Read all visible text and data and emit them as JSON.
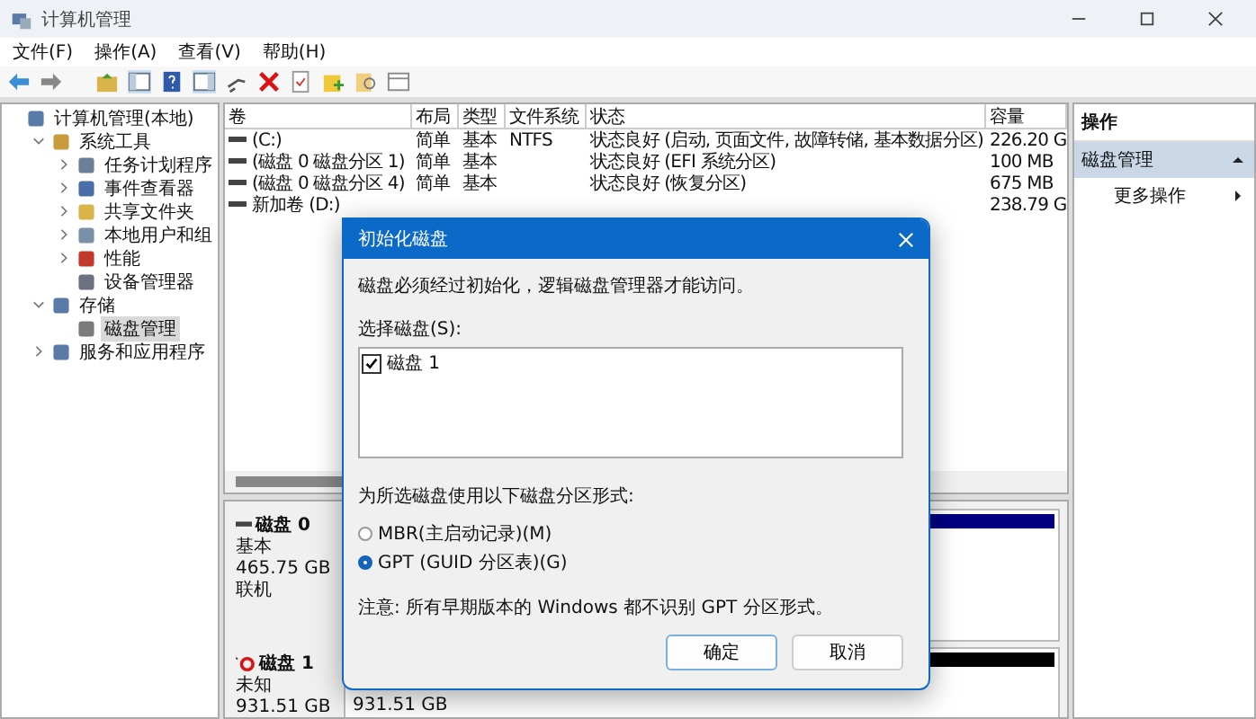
{
  "window": {
    "title": "计算机管理"
  },
  "menu": [
    "文件(F)",
    "操作(A)",
    "查看(V)",
    "帮助(H)"
  ],
  "tree": [
    {
      "label": "计算机管理(本地)",
      "children": [
        {
          "label": "系统工具",
          "expanded": true,
          "children": [
            {
              "label": "任务计划程序",
              "expanded": false
            },
            {
              "label": "事件查看器",
              "expanded": false
            },
            {
              "label": "共享文件夹",
              "expanded": false
            },
            {
              "label": "本地用户和组",
              "expanded": false
            },
            {
              "label": "性能",
              "expanded": false
            },
            {
              "label": "设备管理器"
            }
          ]
        },
        {
          "label": "存储",
          "expanded": true,
          "children": [
            {
              "label": "磁盘管理",
              "selected": true
            }
          ]
        },
        {
          "label": "服务和应用程序",
          "expanded": false
        }
      ]
    }
  ],
  "volumes": {
    "columns": [
      "卷",
      "布局",
      "类型",
      "文件系统",
      "状态",
      "容量"
    ],
    "rows": [
      {
        "volume": "(C:)",
        "layout": "简单",
        "type": "基本",
        "fs": "NTFS",
        "status": "状态良好 (启动, 页面文件, 故障转储, 基本数据分区)",
        "capacity": "226.20 G"
      },
      {
        "volume": "(磁盘 0 磁盘分区 1)",
        "layout": "简单",
        "type": "基本",
        "status": "状态良好 (EFI 系统分区)",
        "capacity": "100 MB"
      },
      {
        "volume": "(磁盘 0 磁盘分区 4)",
        "layout": "简单",
        "type": "基本",
        "status": "状态良好 (恢复分区)",
        "capacity": "675 MB"
      },
      {
        "volume": "新加卷 (D:)",
        "capacity": "238.79 G"
      }
    ]
  },
  "disks": [
    {
      "name": "磁盘 0",
      "initialized": true,
      "lines": [
        "基本",
        "465.75 GB",
        "联机"
      ]
    },
    {
      "name": "磁盘 1",
      "initialized": false,
      "lines": [
        "未知",
        "931.51 GB"
      ],
      "partition_lines": [
        "931.51 GB"
      ]
    }
  ],
  "actions": {
    "title": "操作",
    "section": "磁盘管理",
    "items": [
      "更多操作"
    ]
  },
  "dialog": {
    "title": "初始化磁盘",
    "message": "磁盘必须经过初始化，逻辑磁盘管理器才能访问。",
    "list_label": "选择磁盘(S):",
    "disks": [
      {
        "label": "磁盘 1",
        "checked": true
      }
    ],
    "style_label": "为所选磁盘使用以下磁盘分区形式:",
    "options": [
      {
        "label": "MBR(主启动记录)(M)",
        "selected": false
      },
      {
        "label": "GPT (GUID 分区表)(G)",
        "selected": true
      }
    ],
    "note": "注意: 所有早期版本的 Windows 都不识别 GPT 分区形式。",
    "buttons": [
      "确定",
      "取消"
    ]
  }
}
